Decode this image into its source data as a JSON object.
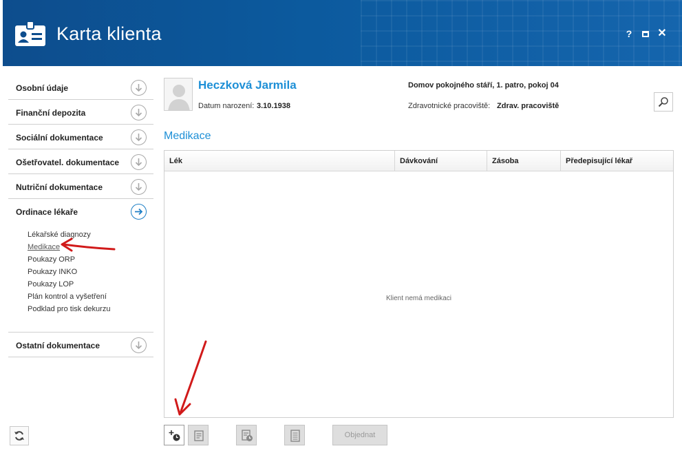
{
  "window": {
    "title": "Karta klienta",
    "help": "?",
    "close": "✕"
  },
  "sidebar": {
    "items": [
      {
        "label": "Osobní údaje"
      },
      {
        "label": "Finanční depozita"
      },
      {
        "label": "Sociální dokumentace"
      },
      {
        "label": "Ošetřovatel. dokumentace"
      },
      {
        "label": "Nutriční dokumentace"
      },
      {
        "label": "Ordinace lékaře"
      },
      {
        "label": "Ostatní dokumentace"
      }
    ],
    "active_index": 5,
    "submenu": [
      "Lékařské diagnozy",
      "Medikace",
      "Poukazy ORP",
      "Poukazy INKO",
      "Poukazy LOP",
      "Plán kontrol a vyšetření",
      "Podklad pro tisk dekurzu"
    ],
    "current_submenu": "Medikace"
  },
  "client": {
    "name": "Heczková Jarmila",
    "dob_label": "Datum narození:",
    "dob": "3.10.1938",
    "location": "Domov pokojného stáří, 1. patro, pokoj 04",
    "workplace_label": "Zdravotnické pracoviště:",
    "workplace": "Zdrav. pracoviště"
  },
  "section": {
    "title": "Medikace"
  },
  "table": {
    "columns": [
      "Lék",
      "Dávkování",
      "Zásoba",
      "Předepisující lékař"
    ],
    "rows": [],
    "empty_message": "Klient nemá medikaci"
  },
  "toolbar": {
    "order_label": "Objednat"
  },
  "colors": {
    "header_bg": "#0c5a9e",
    "accent": "#1d8fd6",
    "annotation_arrow": "#d11a1a"
  }
}
